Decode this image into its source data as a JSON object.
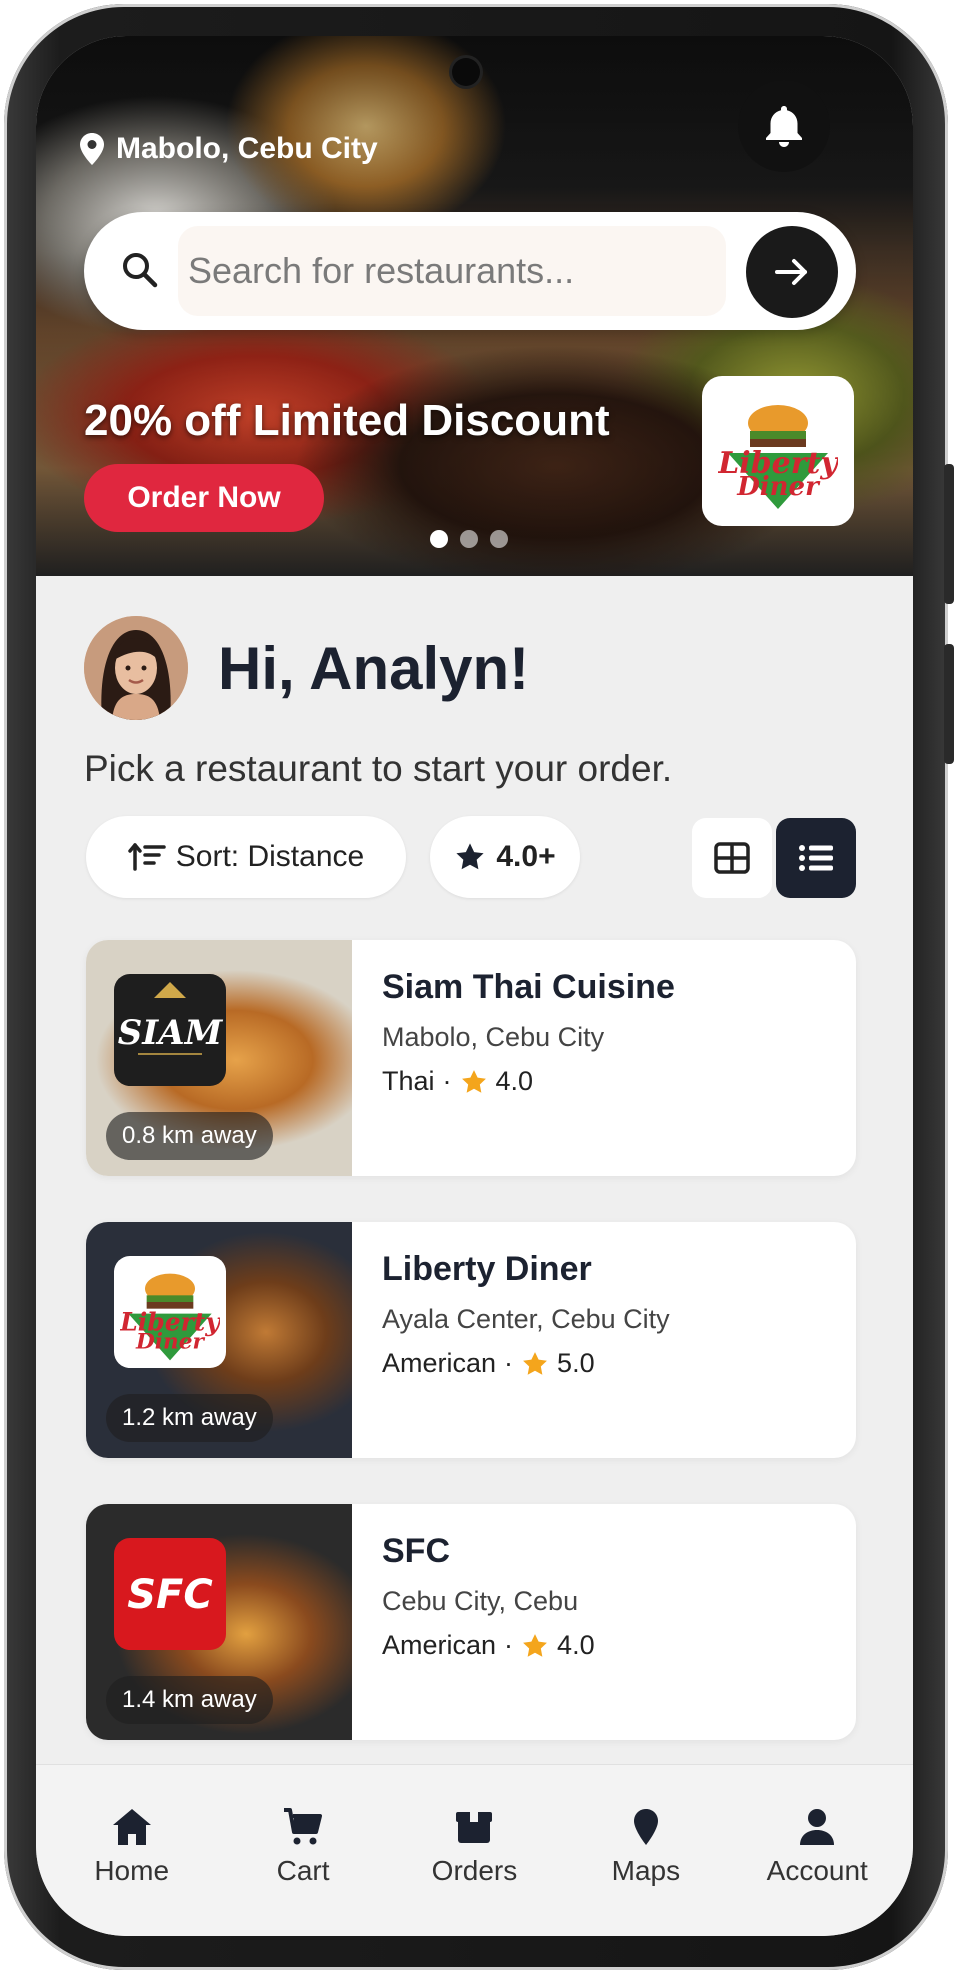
{
  "header": {
    "location": "Mabolo, Cebu City"
  },
  "search": {
    "placeholder": "Search for restaurants..."
  },
  "promo": {
    "title": "20% off Limited Discount",
    "cta": "Order Now",
    "brand_logo_text": "Liberty Diner",
    "slides": 3,
    "active_slide": 1
  },
  "greeting": {
    "title": "Hi, Analyn!",
    "subtitle": "Pick a restaurant to start your order."
  },
  "filters": {
    "sort_label": "Sort: Distance",
    "rating_label": "4.0+",
    "active_view": "list"
  },
  "restaurants": [
    {
      "name": "Siam Thai Cuisine",
      "location": "Mabolo, Cebu City",
      "cuisine": "Thai",
      "rating": "4.0",
      "distance": "0.8 km away",
      "logo": "SIAM"
    },
    {
      "name": "Liberty Diner",
      "location": "Ayala Center, Cebu City",
      "cuisine": "American",
      "rating": "5.0",
      "distance": "1.2 km away",
      "logo": "Liberty Diner"
    },
    {
      "name": "SFC",
      "location": "Cebu City, Cebu",
      "cuisine": "American",
      "rating": "4.0",
      "distance": "1.4 km away",
      "logo": "SFC"
    }
  ],
  "nav": [
    {
      "label": "Home",
      "icon": "home-icon",
      "active": true
    },
    {
      "label": "Cart",
      "icon": "cart-icon"
    },
    {
      "label": "Orders",
      "icon": "orders-icon"
    },
    {
      "label": "Maps",
      "icon": "map-pin-icon"
    },
    {
      "label": "Account",
      "icon": "account-icon"
    }
  ],
  "colors": {
    "accent": "#e0273f",
    "dark": "#1c2230",
    "star": "#f4a51c"
  }
}
